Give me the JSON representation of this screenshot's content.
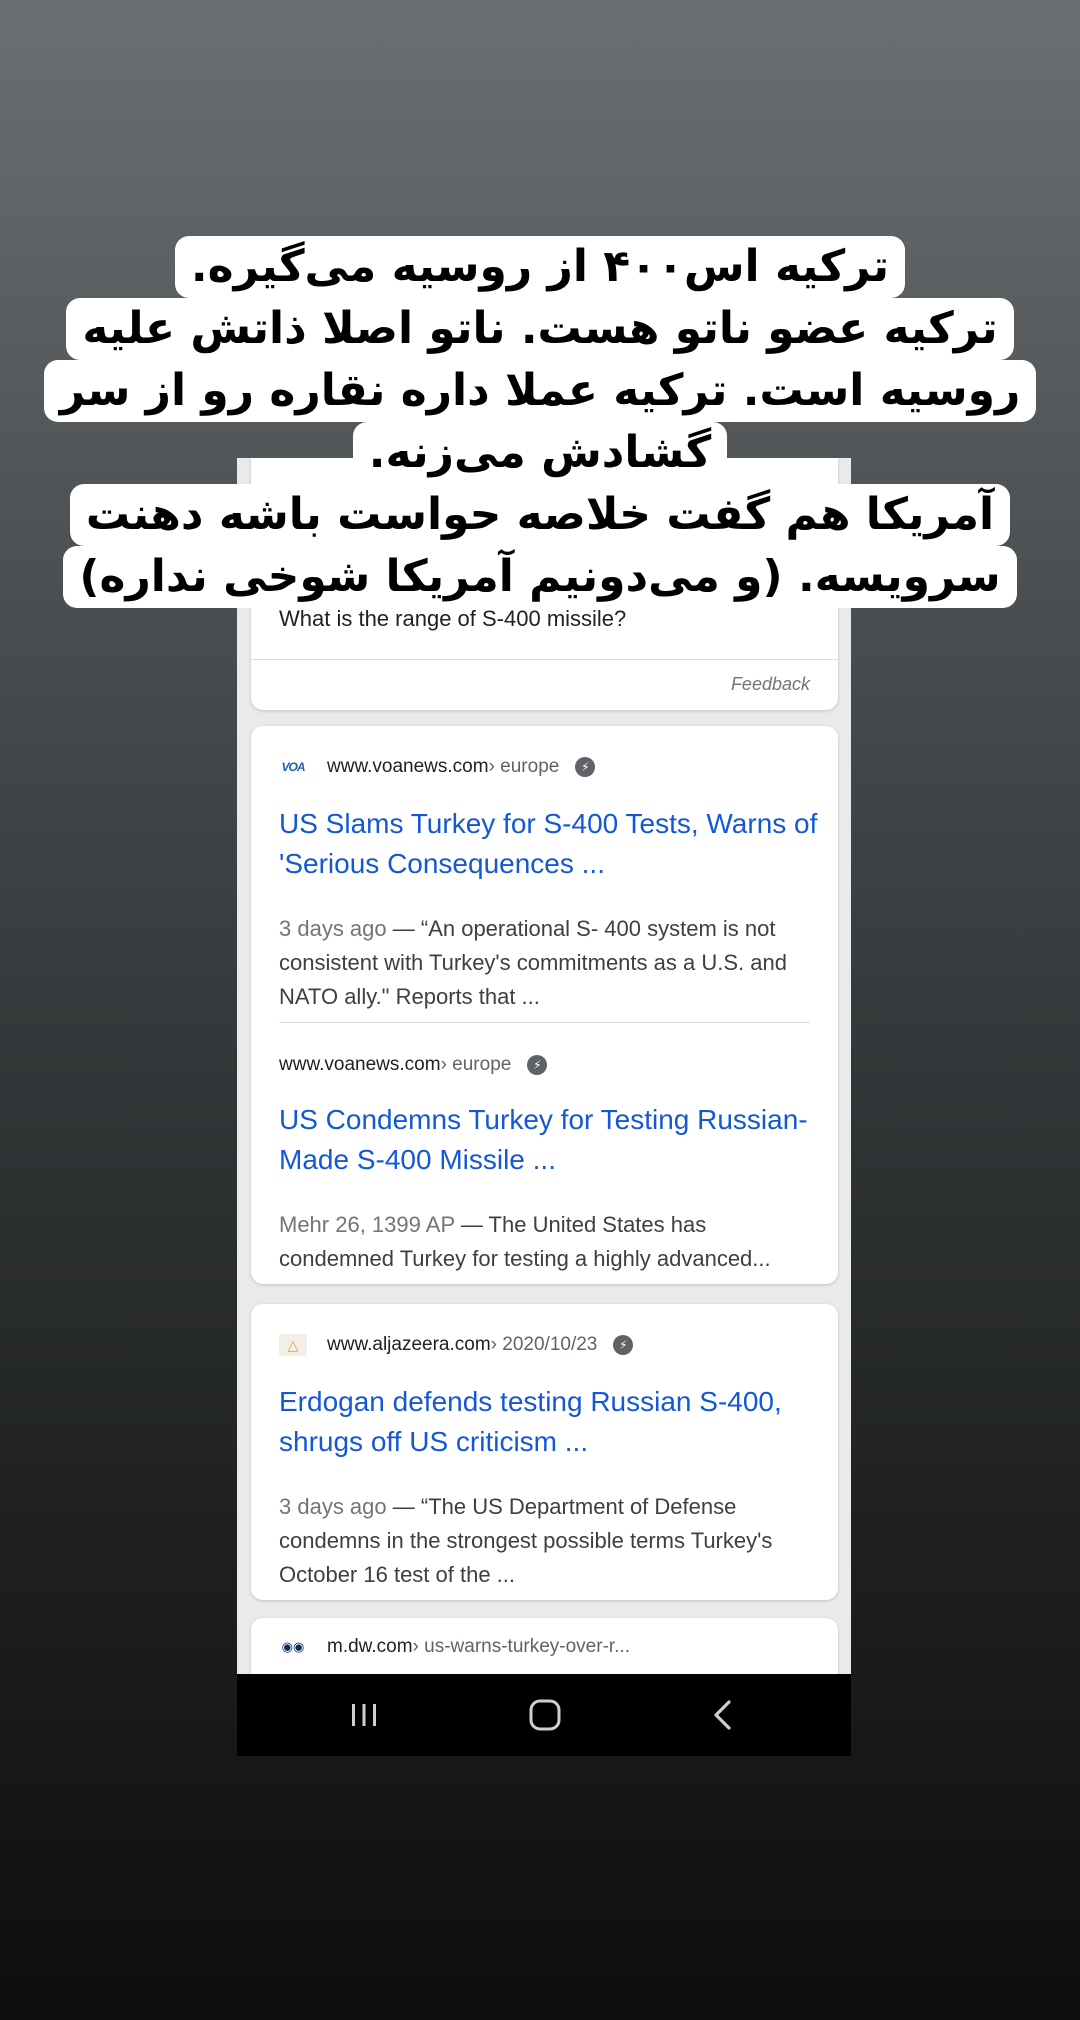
{
  "caption": {
    "lines": [
      "ترکیه اس۴۰۰ از روسیه می‌گیره.",
      "ترکیه عضو ناتو هست. ناتو اصلا ذاتش علیه",
      "روسیه است. ترکیه عملا داره نقاره رو از سر",
      "گشادش می‌زنه.",
      "آمریکا هم گفت خلاصه حواست باشه دهنت",
      "سرویسه. (و می‌دونیم آمریکا شوخی نداره)"
    ]
  },
  "search": {
    "faq_partial": "What is the range of S-400 missile?",
    "feedback_label": "Feedback",
    "results": [
      {
        "favicon": "VOA",
        "domain": "www.voanews.com",
        "crumb": " › europe",
        "title": "US Slams Turkey for S-400 Tests, Warns of 'Serious Consequences ...",
        "date": "3 days ago",
        "snippet": " — “An operational S- 400 system is not consistent with Turkey's commitments as a U.S. and NATO ally.\" Reports that ..."
      },
      {
        "domain": "www.voanews.com",
        "crumb": " › europe",
        "title": "US Condemns Turkey for Testing Russian-Made S-400 Missile ...",
        "date": "Mehr 26, 1399 AP",
        "snippet": " — The United States has condemned Turkey for testing a highly advanced..."
      },
      {
        "favicon": "AJ",
        "domain": "www.aljazeera.com",
        "crumb": " › 2020/10/23",
        "title": "Erdogan defends testing Russian S-400, shrugs off US criticism ...",
        "date": "3 days ago",
        "snippet": " — “The US Department of Defense condemns in the strongest possible terms Turkey's October 16 test of the ..."
      },
      {
        "favicon": "DW",
        "domain": "m.dw.com",
        "crumb": " › us-warns-turkey-over-r..."
      }
    ]
  },
  "navbar": {
    "icons": [
      "recents-icon",
      "home-icon",
      "back-icon"
    ]
  },
  "colors": {
    "link": "#1558d6",
    "snippet": "#3c4043",
    "caption_bg": "#ffffff"
  }
}
